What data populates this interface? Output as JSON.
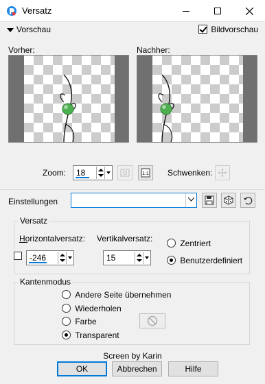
{
  "window": {
    "title": "Versatz",
    "minimize_icon": "minimize-icon",
    "maximize_icon": "maximize-icon",
    "close_icon": "close-icon"
  },
  "preview": {
    "toggle_label": "Vorschau",
    "bildvorschau_label": "Bildvorschau",
    "bildvorschau_checked": true,
    "vorher_label": "Vorher:",
    "nachher_label": "Nachher:"
  },
  "zoom": {
    "label": "Zoom:",
    "value": "18",
    "pan_label": "Schwenken:"
  },
  "einstellungen": {
    "label": "Einstellungen",
    "value": ""
  },
  "versatz": {
    "legend": "Versatz",
    "horizontal_label": "Horizontalversatz:",
    "horizontal_value": "-246",
    "vertikal_label": "Vertikalversatz:",
    "vertikal_value": "15",
    "zentriert_label": "Zentriert",
    "benutzerdefiniert_label": "Benutzerdefiniert",
    "selected": "Benutzerdefiniert"
  },
  "kantenmodus": {
    "legend": "Kantenmodus",
    "options": [
      "Andere Seite übernehmen",
      "Wiederholen",
      "Farbe",
      "Transparent"
    ],
    "selected": "Transparent"
  },
  "footer": {
    "credit": "Screen by Karin",
    "ok": "OK",
    "abbrechen": "Abbrechen",
    "hilfe": "Hilfe"
  },
  "colors": {
    "accent": "#0078d7",
    "preview_bg": "#707070",
    "object_green": "#4caf50"
  }
}
